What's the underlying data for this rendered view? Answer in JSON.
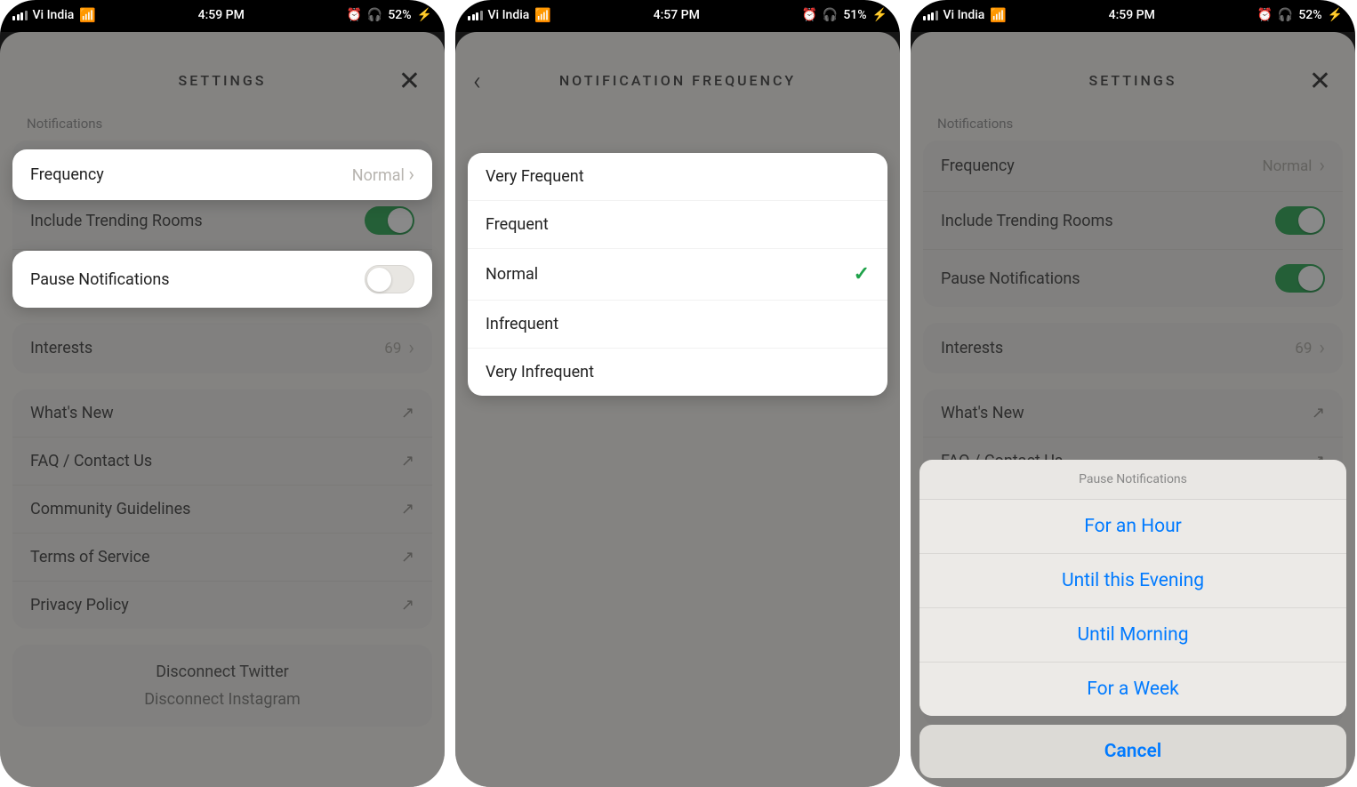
{
  "status": {
    "carrier": "Vi India",
    "time_p1": "4:59 PM",
    "time_p2": "4:57 PM",
    "time_p3": "4:59 PM",
    "batt_p1": "52%",
    "batt_p2": "51%",
    "batt_p3": "52%"
  },
  "headers": {
    "settings": "SETTINGS",
    "freq": "NOTIFICATION FREQUENCY"
  },
  "labels": {
    "notifications": "Notifications",
    "frequency": "Frequency",
    "frequency_value": "Normal",
    "trending": "Include Trending Rooms",
    "pause": "Pause Notifications",
    "interests": "Interests",
    "interests_count": "69",
    "whats_new": "What's New",
    "faq": "FAQ / Contact Us",
    "community": "Community Guidelines",
    "tos": "Terms of Service",
    "privacy": "Privacy Policy",
    "disc_twitter": "Disconnect Twitter",
    "disc_insta": "Disconnect Instagram"
  },
  "freq_options": {
    "o1": "Very Frequent",
    "o2": "Frequent",
    "o3": "Normal",
    "o4": "Infrequent",
    "o5": "Very Infrequent"
  },
  "action_sheet": {
    "title": "Pause Notifications",
    "a1": "For an Hour",
    "a2": "Until this Evening",
    "a3": "Until Morning",
    "a4": "For a Week",
    "cancel": "Cancel"
  }
}
